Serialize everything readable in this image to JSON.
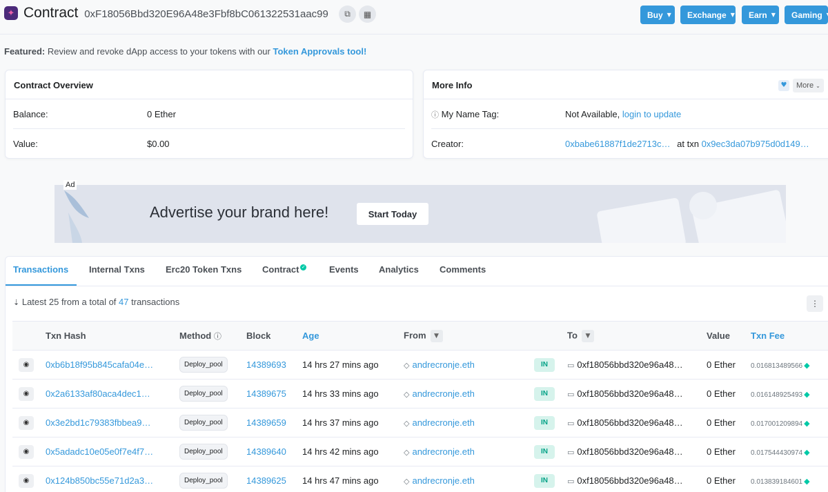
{
  "header": {
    "title": "Contract",
    "address": "0xF18056Bbd320E96A48e3Fbf8bC061322531aac99",
    "nav": [
      "Buy",
      "Exchange",
      "Earn",
      "Gaming"
    ]
  },
  "featured": {
    "label": "Featured:",
    "text": "Review and revoke dApp access to your tokens with our",
    "link": "Token Approvals tool!"
  },
  "overview": {
    "title": "Contract Overview",
    "balance_label": "Balance:",
    "balance_value": "0 Ether",
    "value_label": "Value:",
    "value_value": "$0.00"
  },
  "more_info": {
    "title": "More Info",
    "more_label": "More",
    "name_tag_label": "My Name Tag:",
    "name_tag_value": "Not Available,",
    "name_tag_link": "login to update",
    "creator_label": "Creator:",
    "creator_address": "0xbabe61887f1de2713c…",
    "at_txn": "at txn",
    "creator_txn": "0x9ec3da07b975d0d149…"
  },
  "ad": {
    "tag": "Ad",
    "text": "Advertise your brand here!",
    "button": "Start Today"
  },
  "tabs": [
    "Transactions",
    "Internal Txns",
    "Erc20 Token Txns",
    "Contract",
    "Events",
    "Analytics",
    "Comments"
  ],
  "summary": {
    "prefix": "Latest 25 from a total of",
    "count": "47",
    "suffix": "transactions"
  },
  "columns": [
    "Txn Hash",
    "Method",
    "Block",
    "Age",
    "From",
    "To",
    "Value",
    "Txn Fee"
  ],
  "rows": [
    {
      "hash": "0xb6b18f95b845cafa04e…",
      "method": "Deploy_pool",
      "block": "14389693",
      "age": "14 hrs 27 mins ago",
      "from": "andrecronje.eth",
      "dir": "IN",
      "to": "0xf18056bbd320e96a48…",
      "value": "0 Ether",
      "fee": "0.016813489566"
    },
    {
      "hash": "0x2a6133af80aca4dec1…",
      "method": "Deploy_pool",
      "block": "14389675",
      "age": "14 hrs 33 mins ago",
      "from": "andrecronje.eth",
      "dir": "IN",
      "to": "0xf18056bbd320e96a48…",
      "value": "0 Ether",
      "fee": "0.016148925493"
    },
    {
      "hash": "0x3e2bd1c79383fbbea9…",
      "method": "Deploy_pool",
      "block": "14389659",
      "age": "14 hrs 37 mins ago",
      "from": "andrecronje.eth",
      "dir": "IN",
      "to": "0xf18056bbd320e96a48…",
      "value": "0 Ether",
      "fee": "0.017001209894"
    },
    {
      "hash": "0x5adadc10e05e0f7e4f7…",
      "method": "Deploy_pool",
      "block": "14389640",
      "age": "14 hrs 42 mins ago",
      "from": "andrecronje.eth",
      "dir": "IN",
      "to": "0xf18056bbd320e96a48…",
      "value": "0 Ether",
      "fee": "0.017544430974"
    },
    {
      "hash": "0x124b850bc55e71d2a3…",
      "method": "Deploy_pool",
      "block": "14389625",
      "age": "14 hrs 47 mins ago",
      "from": "andrecronje.eth",
      "dir": "IN",
      "to": "0xf18056bbd320e96a48…",
      "value": "0 Ether",
      "fee": "0.013839184601"
    }
  ]
}
